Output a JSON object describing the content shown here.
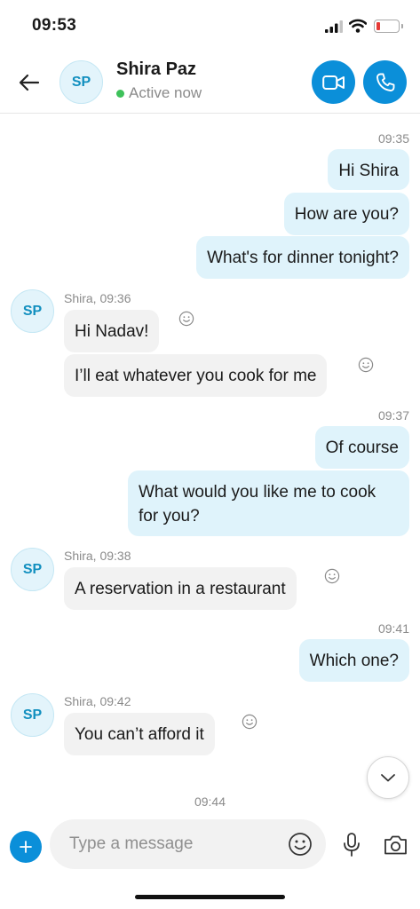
{
  "status_bar": {
    "time": "09:53"
  },
  "header": {
    "contact_initials": "SP",
    "contact_name": "Shira Paz",
    "presence": "Active now"
  },
  "conversation": {
    "time_1": "09:35",
    "out_1": "Hi Shira",
    "out_2": "How are you?",
    "out_3": "What's for dinner tonight?",
    "meta_1": "Shira, 09:36",
    "in_1": "Hi Nadav!",
    "in_2": "I’ll eat whatever you cook for me",
    "time_2": "09:37",
    "out_4": "Of course",
    "out_5": "What would you like me to cook for you?",
    "meta_2": "Shira, 09:38",
    "in_3": "A reservation in a restaurant",
    "time_3": "09:41",
    "out_6": "Which one?",
    "meta_3": "Shira, 09:42",
    "in_4": "You can’t afford it",
    "time_4": "09:44",
    "avatar_initials": "SP"
  },
  "composer": {
    "placeholder": "Type a message"
  },
  "colors": {
    "accent": "#0b8fd9",
    "outgoing_bubble": "#dff3fb",
    "incoming_bubble": "#f2f2f2",
    "online": "#3ec15a"
  }
}
